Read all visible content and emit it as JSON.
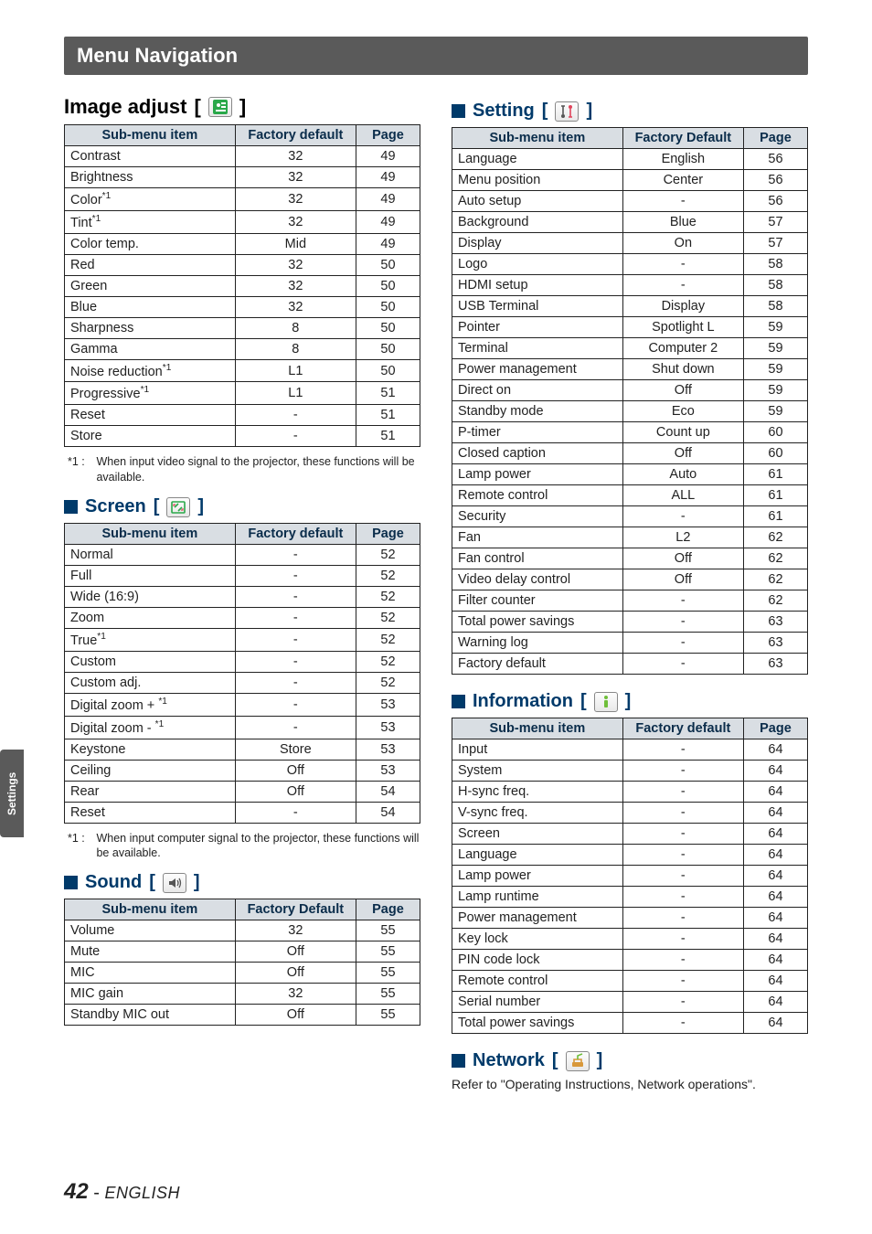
{
  "page_number": "42",
  "page_lang": "ENGLISH",
  "side_tab": "Settings",
  "title_bar": "Menu Navigation",
  "headers": {
    "s": "Sub-menu item",
    "fd": "Factory default",
    "fD": "Factory Default",
    "pg": "Page"
  },
  "sections": {
    "image_adjust": {
      "title": "Image adjust",
      "b_open": "[",
      "b_close": "]"
    },
    "screen": {
      "title": "Screen",
      "b_open": "[",
      "b_close": "]"
    },
    "sound": {
      "title": "Sound",
      "b_open": "[",
      "b_close": "]"
    },
    "setting": {
      "title": "Setting",
      "b_open": "[",
      "b_close": "]"
    },
    "information": {
      "title": "Information",
      "b_open": "[",
      "b_close": "]"
    },
    "network": {
      "title": "Network",
      "b_open": "[",
      "b_close": "]"
    }
  },
  "footnotes": {
    "image_adjust": {
      "label": "*1 :",
      "text": "When input video signal to the projector, these functions will be available."
    },
    "screen": {
      "label": "*1 :",
      "text": "When input computer signal to the projector, these functions will be available."
    }
  },
  "network_note": "Refer to \"Operating Instructions, Network operations\".",
  "image_adjust_rows": [
    {
      "name": "Contrast",
      "sup": "",
      "fd": "32",
      "pg": "49"
    },
    {
      "name": "Brightness",
      "sup": "",
      "fd": "32",
      "pg": "49"
    },
    {
      "name": "Color",
      "sup": "*1",
      "fd": "32",
      "pg": "49"
    },
    {
      "name": "Tint",
      "sup": "*1",
      "fd": "32",
      "pg": "49"
    },
    {
      "name": "Color temp.",
      "sup": "",
      "fd": "Mid",
      "pg": "49"
    },
    {
      "name": "Red",
      "sup": "",
      "fd": "32",
      "pg": "50"
    },
    {
      "name": "Green",
      "sup": "",
      "fd": "32",
      "pg": "50"
    },
    {
      "name": "Blue",
      "sup": "",
      "fd": "32",
      "pg": "50"
    },
    {
      "name": "Sharpness",
      "sup": "",
      "fd": "8",
      "pg": "50"
    },
    {
      "name": "Gamma",
      "sup": "",
      "fd": "8",
      "pg": "50"
    },
    {
      "name": "Noise reduction",
      "sup": "*1",
      "fd": "L1",
      "pg": "50"
    },
    {
      "name": "Progressive",
      "sup": "*1",
      "fd": "L1",
      "pg": "51"
    },
    {
      "name": "Reset",
      "sup": "",
      "fd": "-",
      "pg": "51"
    },
    {
      "name": "Store",
      "sup": "",
      "fd": "-",
      "pg": "51"
    }
  ],
  "screen_rows": [
    {
      "name": "Normal",
      "sup": "",
      "fd": "-",
      "pg": "52"
    },
    {
      "name": "Full",
      "sup": "",
      "fd": "-",
      "pg": "52"
    },
    {
      "name": "Wide (16:9)",
      "sup": "",
      "fd": "-",
      "pg": "52"
    },
    {
      "name": "Zoom",
      "sup": "",
      "fd": "-",
      "pg": "52"
    },
    {
      "name": "True",
      "sup": "*1",
      "fd": "-",
      "pg": "52"
    },
    {
      "name": "Custom",
      "sup": "",
      "fd": "-",
      "pg": "52"
    },
    {
      "name": "Custom adj.",
      "sup": "",
      "fd": "-",
      "pg": "52"
    },
    {
      "name": "Digital zoom + ",
      "sup": "*1",
      "fd": "-",
      "pg": "53"
    },
    {
      "name": "Digital zoom - ",
      "sup": "*1",
      "fd": "-",
      "pg": "53"
    },
    {
      "name": "Keystone",
      "sup": "",
      "fd": "Store",
      "pg": "53"
    },
    {
      "name": "Ceiling",
      "sup": "",
      "fd": "Off",
      "pg": "53"
    },
    {
      "name": "Rear",
      "sup": "",
      "fd": "Off",
      "pg": "54"
    },
    {
      "name": "Reset",
      "sup": "",
      "fd": "-",
      "pg": "54"
    }
  ],
  "sound_rows": [
    {
      "name": "Volume",
      "fd": "32",
      "pg": "55"
    },
    {
      "name": "Mute",
      "fd": "Off",
      "pg": "55"
    },
    {
      "name": "MIC",
      "fd": "Off",
      "pg": "55"
    },
    {
      "name": "MIC gain",
      "fd": "32",
      "pg": "55"
    },
    {
      "name": "Standby MIC out",
      "fd": "Off",
      "pg": "55"
    }
  ],
  "setting_rows": [
    {
      "name": "Language",
      "fd": "English",
      "pg": "56"
    },
    {
      "name": "Menu position",
      "fd": "Center",
      "pg": "56"
    },
    {
      "name": "Auto setup",
      "fd": "-",
      "pg": "56"
    },
    {
      "name": "Background",
      "fd": "Blue",
      "pg": "57"
    },
    {
      "name": "Display",
      "fd": "On",
      "pg": "57"
    },
    {
      "name": "Logo",
      "fd": "-",
      "pg": "58"
    },
    {
      "name": "HDMI setup",
      "fd": "-",
      "pg": "58"
    },
    {
      "name": "USB Terminal",
      "fd": "Display",
      "pg": "58"
    },
    {
      "name": "Pointer",
      "fd": "Spotlight L",
      "pg": "59"
    },
    {
      "name": "Terminal",
      "fd": "Computer 2",
      "pg": "59"
    },
    {
      "name": "Power management",
      "fd": "Shut down",
      "pg": "59"
    },
    {
      "name": "Direct on",
      "fd": "Off",
      "pg": "59"
    },
    {
      "name": "Standby mode",
      "fd": "Eco",
      "pg": "59"
    },
    {
      "name": "P-timer",
      "fd": "Count up",
      "pg": "60"
    },
    {
      "name": "Closed caption",
      "fd": "Off",
      "pg": "60"
    },
    {
      "name": "Lamp power",
      "fd": "Auto",
      "pg": "61"
    },
    {
      "name": "Remote control",
      "fd": "ALL",
      "pg": "61"
    },
    {
      "name": "Security",
      "fd": "-",
      "pg": "61"
    },
    {
      "name": "Fan",
      "fd": "L2",
      "pg": "62"
    },
    {
      "name": "Fan control",
      "fd": "Off",
      "pg": "62"
    },
    {
      "name": "Video delay control",
      "fd": "Off",
      "pg": "62"
    },
    {
      "name": "Filter counter",
      "fd": "-",
      "pg": "62"
    },
    {
      "name": "Total power savings",
      "fd": "-",
      "pg": "63"
    },
    {
      "name": "Warning log",
      "fd": "-",
      "pg": "63"
    },
    {
      "name": "Factory default",
      "fd": "-",
      "pg": "63"
    }
  ],
  "information_rows": [
    {
      "name": "Input",
      "fd": "-",
      "pg": "64"
    },
    {
      "name": "System",
      "fd": "-",
      "pg": "64"
    },
    {
      "name": "H-sync freq.",
      "fd": "-",
      "pg": "64"
    },
    {
      "name": "V-sync freq.",
      "fd": "-",
      "pg": "64"
    },
    {
      "name": "Screen",
      "fd": "-",
      "pg": "64"
    },
    {
      "name": "Language",
      "fd": "-",
      "pg": "64"
    },
    {
      "name": "Lamp power",
      "fd": "-",
      "pg": "64"
    },
    {
      "name": "Lamp runtime",
      "fd": "-",
      "pg": "64"
    },
    {
      "name": "Power management",
      "fd": "-",
      "pg": "64"
    },
    {
      "name": "Key lock",
      "fd": "-",
      "pg": "64"
    },
    {
      "name": "PIN code lock",
      "fd": "-",
      "pg": "64"
    },
    {
      "name": "Remote control",
      "fd": "-",
      "pg": "64"
    },
    {
      "name": "Serial number",
      "fd": "-",
      "pg": "64"
    },
    {
      "name": "Total power savings",
      "fd": "-",
      "pg": "64"
    }
  ]
}
